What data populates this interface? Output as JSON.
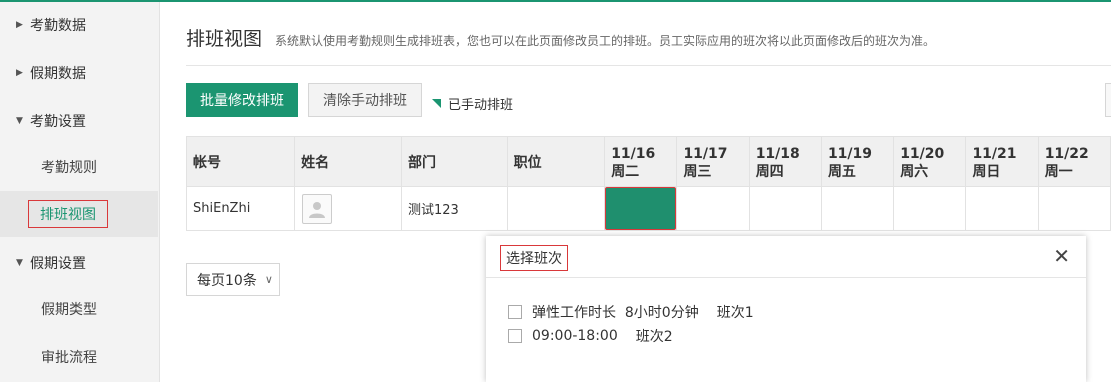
{
  "sidebar": {
    "groups": [
      {
        "label": "考勤数据"
      },
      {
        "label": "假期数据"
      },
      {
        "label": "考勤设置"
      },
      {
        "label": "假期设置"
      }
    ],
    "items": [
      {
        "label": "考勤规则"
      },
      {
        "label": "排班视图"
      },
      {
        "label": "假期类型"
      },
      {
        "label": "审批流程"
      }
    ]
  },
  "header": {
    "title": "排班视图",
    "description": "系统默认使用考勤规则生成排班表，您也可以在此页面修改员工的排班。员工实际应用的班次将以此页面修改后的班次为准。"
  },
  "toolbar": {
    "batch_label": "批量修改排班",
    "clear_label": "清除手动排班",
    "legend_label": "已手动排班"
  },
  "table": {
    "columns": {
      "account": "帐号",
      "name": "姓名",
      "dept": "部门",
      "position": "职位"
    },
    "days": [
      {
        "date": "11/16",
        "weekday": "周二"
      },
      {
        "date": "11/17",
        "weekday": "周三"
      },
      {
        "date": "11/18",
        "weekday": "周四"
      },
      {
        "date": "11/19",
        "weekday": "周五"
      },
      {
        "date": "11/20",
        "weekday": "周六"
      },
      {
        "date": "11/21",
        "weekday": "周日"
      },
      {
        "date": "11/22",
        "weekday": "周一"
      }
    ],
    "rows": [
      {
        "account": "ShiEnZhi",
        "dept": "测试123",
        "position": ""
      }
    ]
  },
  "pager": {
    "label": "每页10条"
  },
  "dialog": {
    "title": "选择班次",
    "options": [
      {
        "time": "弹性工作时长  8小时0分钟",
        "name": "班次1"
      },
      {
        "time": "09:00-18:00",
        "name": "班次2"
      }
    ]
  },
  "colors": {
    "accent": "#1b9571",
    "highlight_border": "#d9383a"
  }
}
